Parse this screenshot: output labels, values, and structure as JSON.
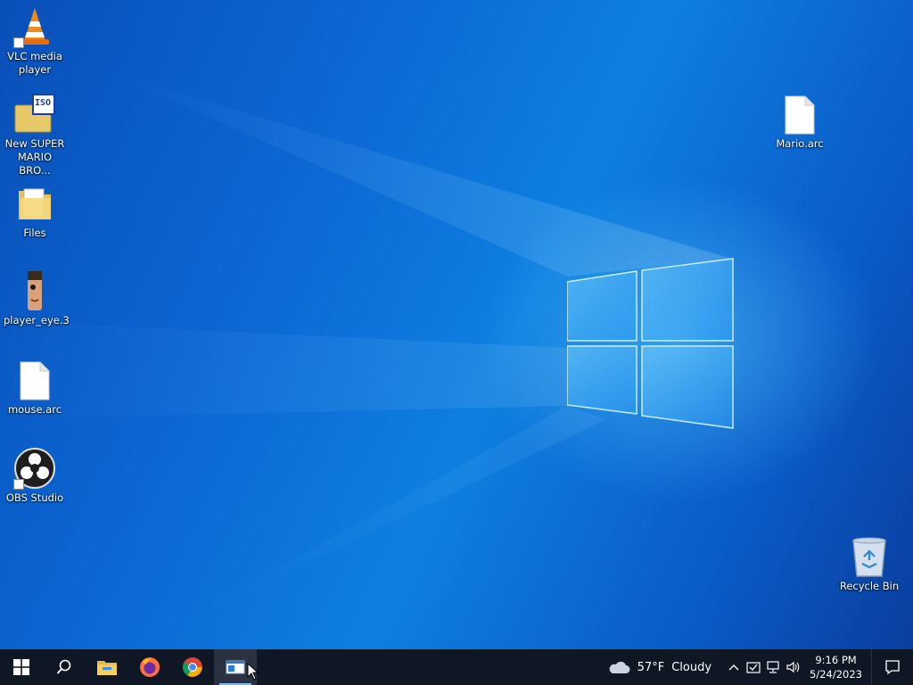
{
  "desktop": {
    "left_icons": [
      {
        "label": "VLC media player",
        "icon": "vlc-cone-icon"
      },
      {
        "label": "New SUPER MARIO BRO...",
        "icon": "iso-image-icon",
        "badge": "ISO"
      },
      {
        "label": "Files",
        "icon": "folder-icon"
      },
      {
        "label": "player_eye.3",
        "icon": "image-file-icon"
      },
      {
        "label": "mouse.arc",
        "icon": "blank-file-icon"
      },
      {
        "label": "OBS Studio",
        "icon": "obs-icon"
      }
    ],
    "right_icons": [
      {
        "label": "Mario.arc",
        "icon": "blank-file-icon"
      },
      {
        "label": "Recycle Bin",
        "icon": "recycle-bin-icon"
      }
    ]
  },
  "taskbar": {
    "apps": [
      {
        "name": "Start",
        "icon": "windows-start-icon"
      },
      {
        "name": "Search",
        "icon": "search-icon"
      },
      {
        "name": "File Explorer",
        "icon": "file-explorer-icon"
      },
      {
        "name": "Firefox",
        "icon": "firefox-icon"
      },
      {
        "name": "Chrome",
        "icon": "chrome-icon"
      },
      {
        "name": "Active app",
        "icon": "window-app-icon",
        "active": true
      }
    ],
    "weather": {
      "temp": "57°F",
      "condition": "Cloudy"
    },
    "clock": {
      "time": "9:16 PM",
      "date": "5/24/2023"
    }
  },
  "colors": {
    "taskbar": "#101724",
    "accent": "#76b9ed",
    "desktop": "#0b66d4"
  }
}
